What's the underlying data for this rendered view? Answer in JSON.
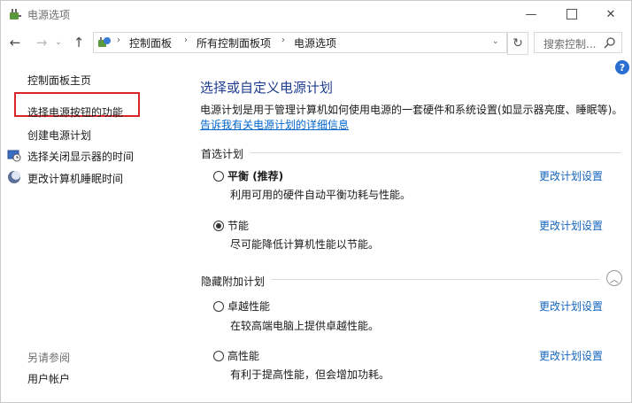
{
  "window": {
    "title": "电源选项",
    "minimize_glyph": "—",
    "close_glyph": "✕"
  },
  "nav": {
    "back_glyph": "←",
    "forward_glyph": "→",
    "recent_glyph": "⌄",
    "up_glyph": "↑",
    "breadcrumbs": [
      "控制面板",
      "所有控制面板项",
      "电源选项"
    ],
    "crumb_separator": "›",
    "refresh_glyph": "↻",
    "search_placeholder": "搜索控制..."
  },
  "help_label": "?",
  "sidebar": {
    "home": "控制面板主页",
    "items": [
      {
        "label": "选择电源按钮的功能",
        "icon": null
      },
      {
        "label": "创建电源计划",
        "icon": null
      },
      {
        "label": "选择关闭显示器的时间",
        "icon": "monitor-clock-icon"
      },
      {
        "label": "更改计算机睡眠时间",
        "icon": "moon-icon"
      }
    ],
    "see_also_title": "另请参阅",
    "see_also_items": [
      "用户帐户"
    ]
  },
  "main": {
    "title": "选择或自定义电源计划",
    "description": "电源计划是用于管理计算机如何使用电源的一套硬件和系统设置(如显示器亮度、睡眠等)。",
    "learn_more": "告诉我有关电源计划的详细信息",
    "preferred_header": "首选计划",
    "hidden_header": "隐藏附加计划",
    "collapse_glyph": "︿",
    "change_label": "更改计划设置",
    "plans": [
      {
        "name": "平衡",
        "suffix": " (推荐)",
        "desc": "利用可用的硬件自动平衡功耗与性能。",
        "selected": false
      },
      {
        "name": "节能",
        "suffix": "",
        "desc": "尽可能降低计算机性能以节能。",
        "selected": true
      },
      {
        "name": "卓越性能",
        "suffix": "",
        "desc": "在较高端电脑上提供卓越性能。",
        "selected": false
      },
      {
        "name": "高性能",
        "suffix": "",
        "desc": "有利于提高性能，但会增加功耗。",
        "selected": false
      }
    ]
  },
  "colors": {
    "title_blue": "#1e3d8f",
    "link_blue": "#1565c0",
    "highlight_red": "#d9262a"
  }
}
